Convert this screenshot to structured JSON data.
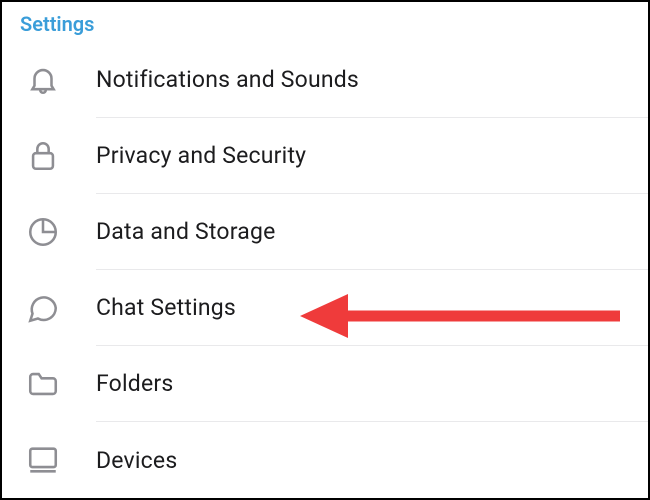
{
  "header": {
    "title": "Settings"
  },
  "items": [
    {
      "icon": "bell-icon",
      "label": "Notifications and Sounds"
    },
    {
      "icon": "lock-icon",
      "label": "Privacy and Security"
    },
    {
      "icon": "pie-icon",
      "label": "Data and Storage"
    },
    {
      "icon": "chat-icon",
      "label": "Chat Settings"
    },
    {
      "icon": "folder-icon",
      "label": "Folders"
    },
    {
      "icon": "device-icon",
      "label": "Devices"
    }
  ],
  "annotation": {
    "type": "red-arrow",
    "points_to": "Chat Settings"
  }
}
